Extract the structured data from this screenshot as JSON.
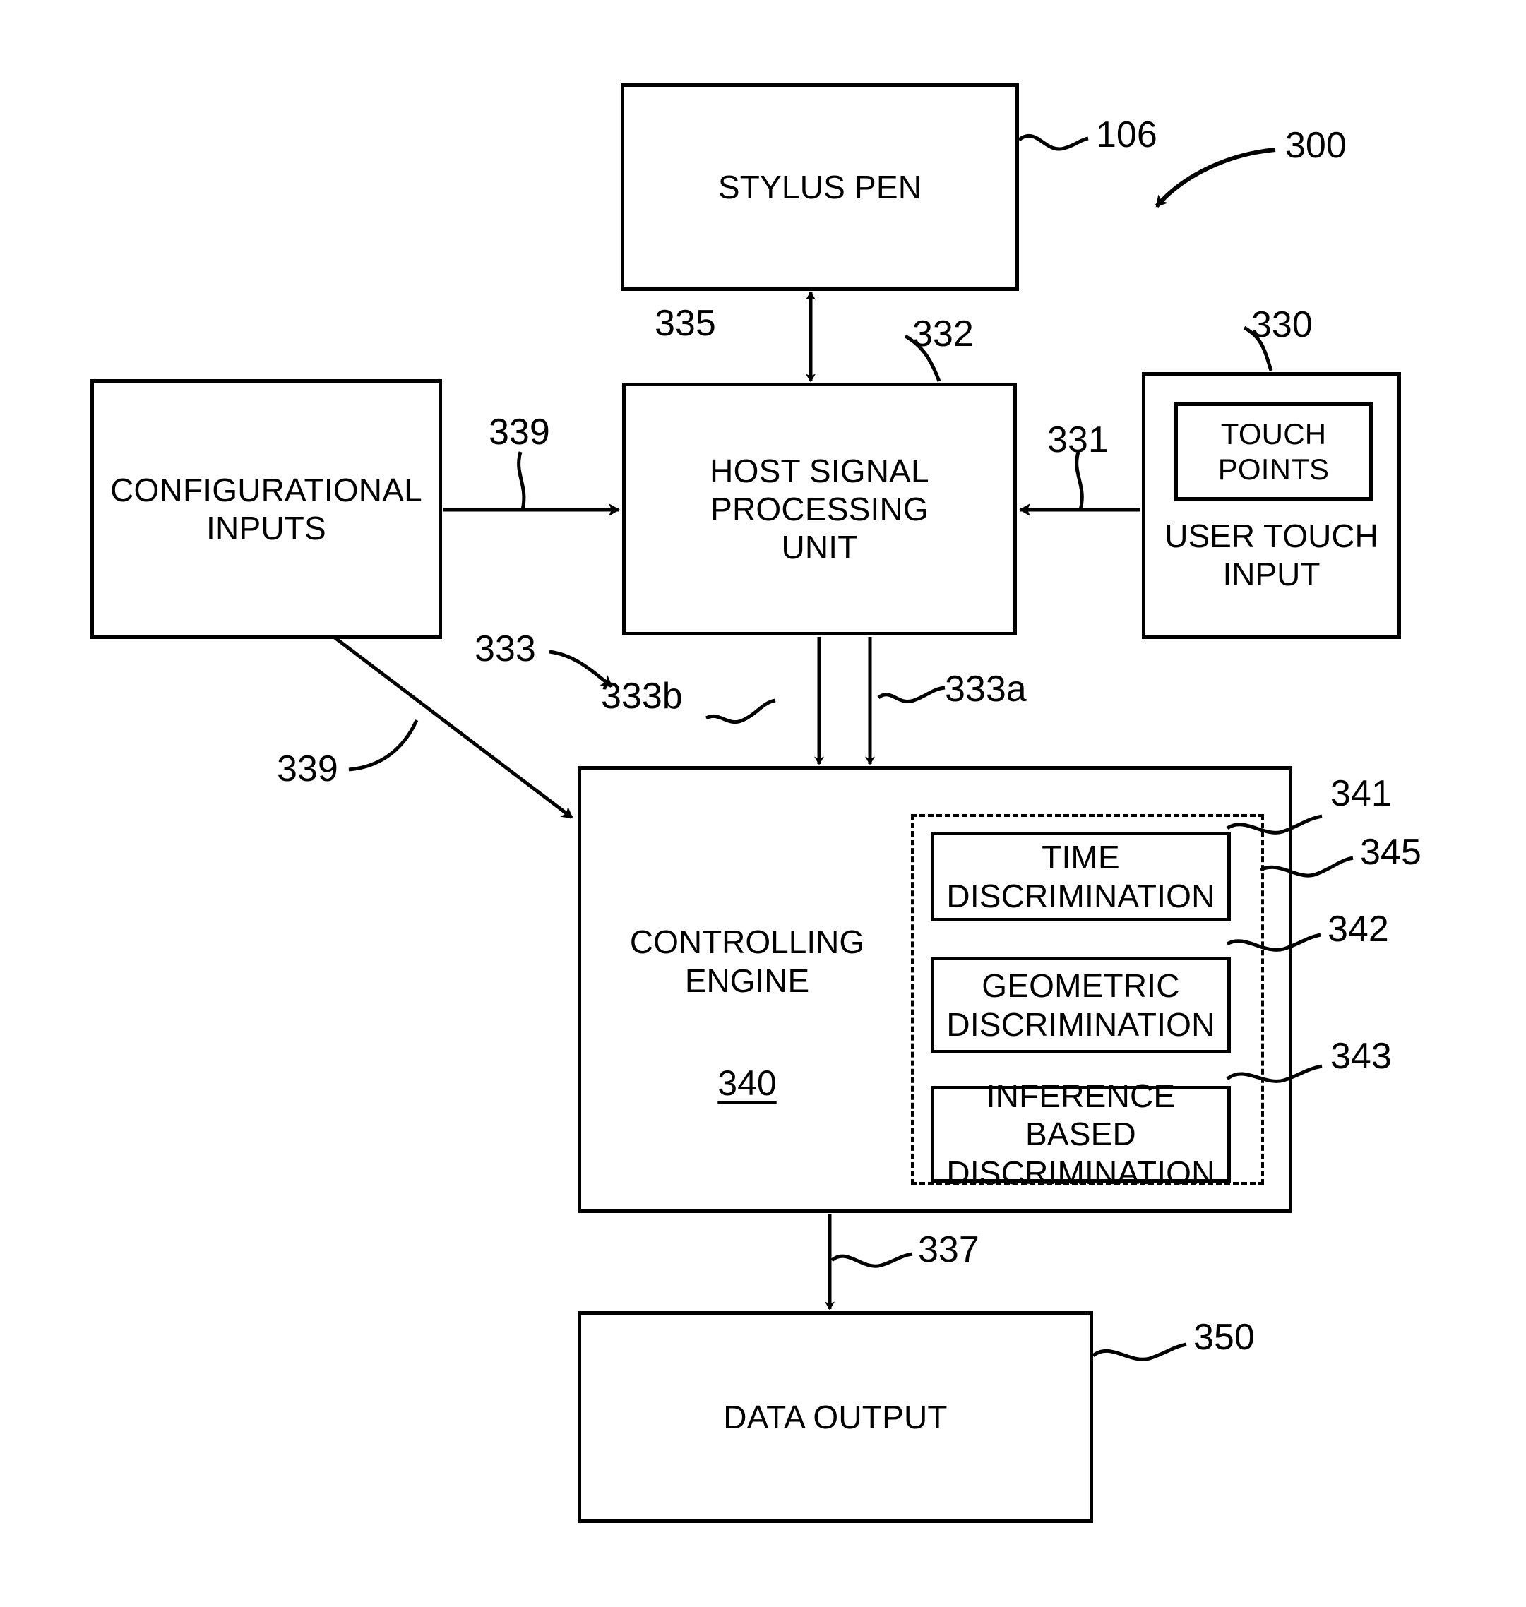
{
  "figure": {
    "number": "300",
    "type": "patent-block-diagram"
  },
  "blocks": {
    "stylus_pen": {
      "label": "STYLUS PEN",
      "ref": "106"
    },
    "host_signal_processing_unit": {
      "label": "HOST SIGNAL\nPROCESSING\nUNIT",
      "ref": "332"
    },
    "configurational_inputs": {
      "label": "CONFIGURATIONAL\nINPUTS"
    },
    "user_touch_input": {
      "label": "USER TOUCH\nINPUT",
      "ref": "330"
    },
    "touch_points": {
      "label": "TOUCH\nPOINTS"
    },
    "controlling_engine": {
      "label": "CONTROLLING\nENGINE",
      "ref": "340"
    },
    "discrimination_group": {
      "ref": "345"
    },
    "time_discrimination": {
      "label": "TIME\nDISCRIMINATION",
      "ref": "341"
    },
    "geometric_discrimination": {
      "label": "GEOMETRIC\nDISCRIMINATION",
      "ref": "342"
    },
    "inference_based_discrimination": {
      "label": "INFERENCE BASED\nDISCRIMINATION",
      "ref": "343"
    },
    "data_output": {
      "label": "DATA OUTPUT",
      "ref": "350"
    }
  },
  "connectors": {
    "stylus_to_host": {
      "ref": "335"
    },
    "config_to_host": {
      "ref": "339"
    },
    "touch_to_host": {
      "ref": "331"
    },
    "host_to_engine_group": {
      "ref": "333"
    },
    "host_to_engine_left": {
      "ref": "333b"
    },
    "host_to_engine_right": {
      "ref": "333a"
    },
    "config_to_engine": {
      "ref": "339"
    },
    "engine_to_output": {
      "ref": "337"
    }
  },
  "colors": {
    "stroke": "#000000",
    "background": "#ffffff"
  }
}
